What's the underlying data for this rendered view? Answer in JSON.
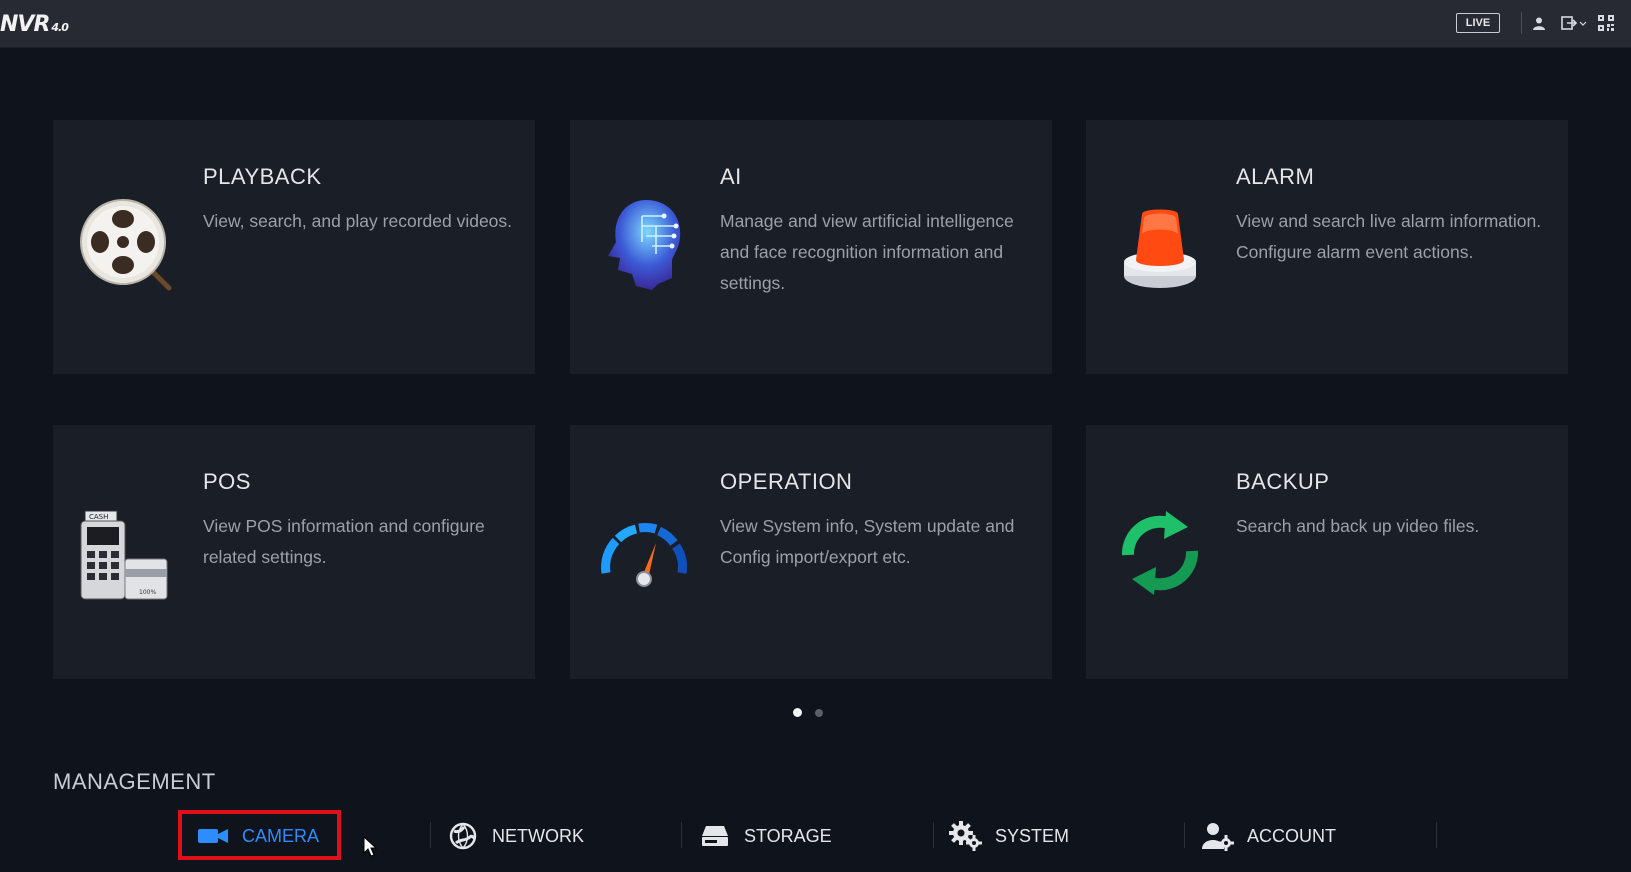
{
  "header": {
    "logo": "NVR",
    "logo_version": "4.0",
    "live_label": "LIVE",
    "icons": [
      "user-icon",
      "logout-icon",
      "qr-code-icon"
    ]
  },
  "tiles": [
    {
      "title": "PLAYBACK",
      "description": "View, search, and play recorded videos.",
      "icon": "film-reel-icon"
    },
    {
      "title": "AI",
      "description": "Manage and view artificial intelligence and face recognition information and settings.",
      "icon": "ai-head-icon"
    },
    {
      "title": "ALARM",
      "description": "View and search live alarm information. Configure alarm event actions.",
      "icon": "alarm-beacon-icon"
    },
    {
      "title": "POS",
      "description": "View POS information and configure related settings.",
      "icon": "pos-terminal-icon"
    },
    {
      "title": "OPERATION",
      "description": "View System info, System update and Config import/export etc.",
      "icon": "gauge-icon"
    },
    {
      "title": "BACKUP",
      "description": "Search and back up video files.",
      "icon": "sync-arrows-icon"
    }
  ],
  "pagination": {
    "current": 1,
    "total": 2
  },
  "management": {
    "title": "MANAGEMENT",
    "items": [
      {
        "label": "CAMERA",
        "icon": "camera-icon",
        "active": true
      },
      {
        "label": "NETWORK",
        "icon": "globe-icon",
        "active": false
      },
      {
        "label": "STORAGE",
        "icon": "hdd-icon",
        "active": false
      },
      {
        "label": "SYSTEM",
        "icon": "gears-icon",
        "active": false
      },
      {
        "label": "ACCOUNT",
        "icon": "user-settings-icon",
        "active": false
      }
    ]
  },
  "colors": {
    "background": "#0f131c",
    "tile": "#1a1e27",
    "topbar": "#272a32",
    "accent": "#2f8cff",
    "highlight": "#e0101a"
  }
}
